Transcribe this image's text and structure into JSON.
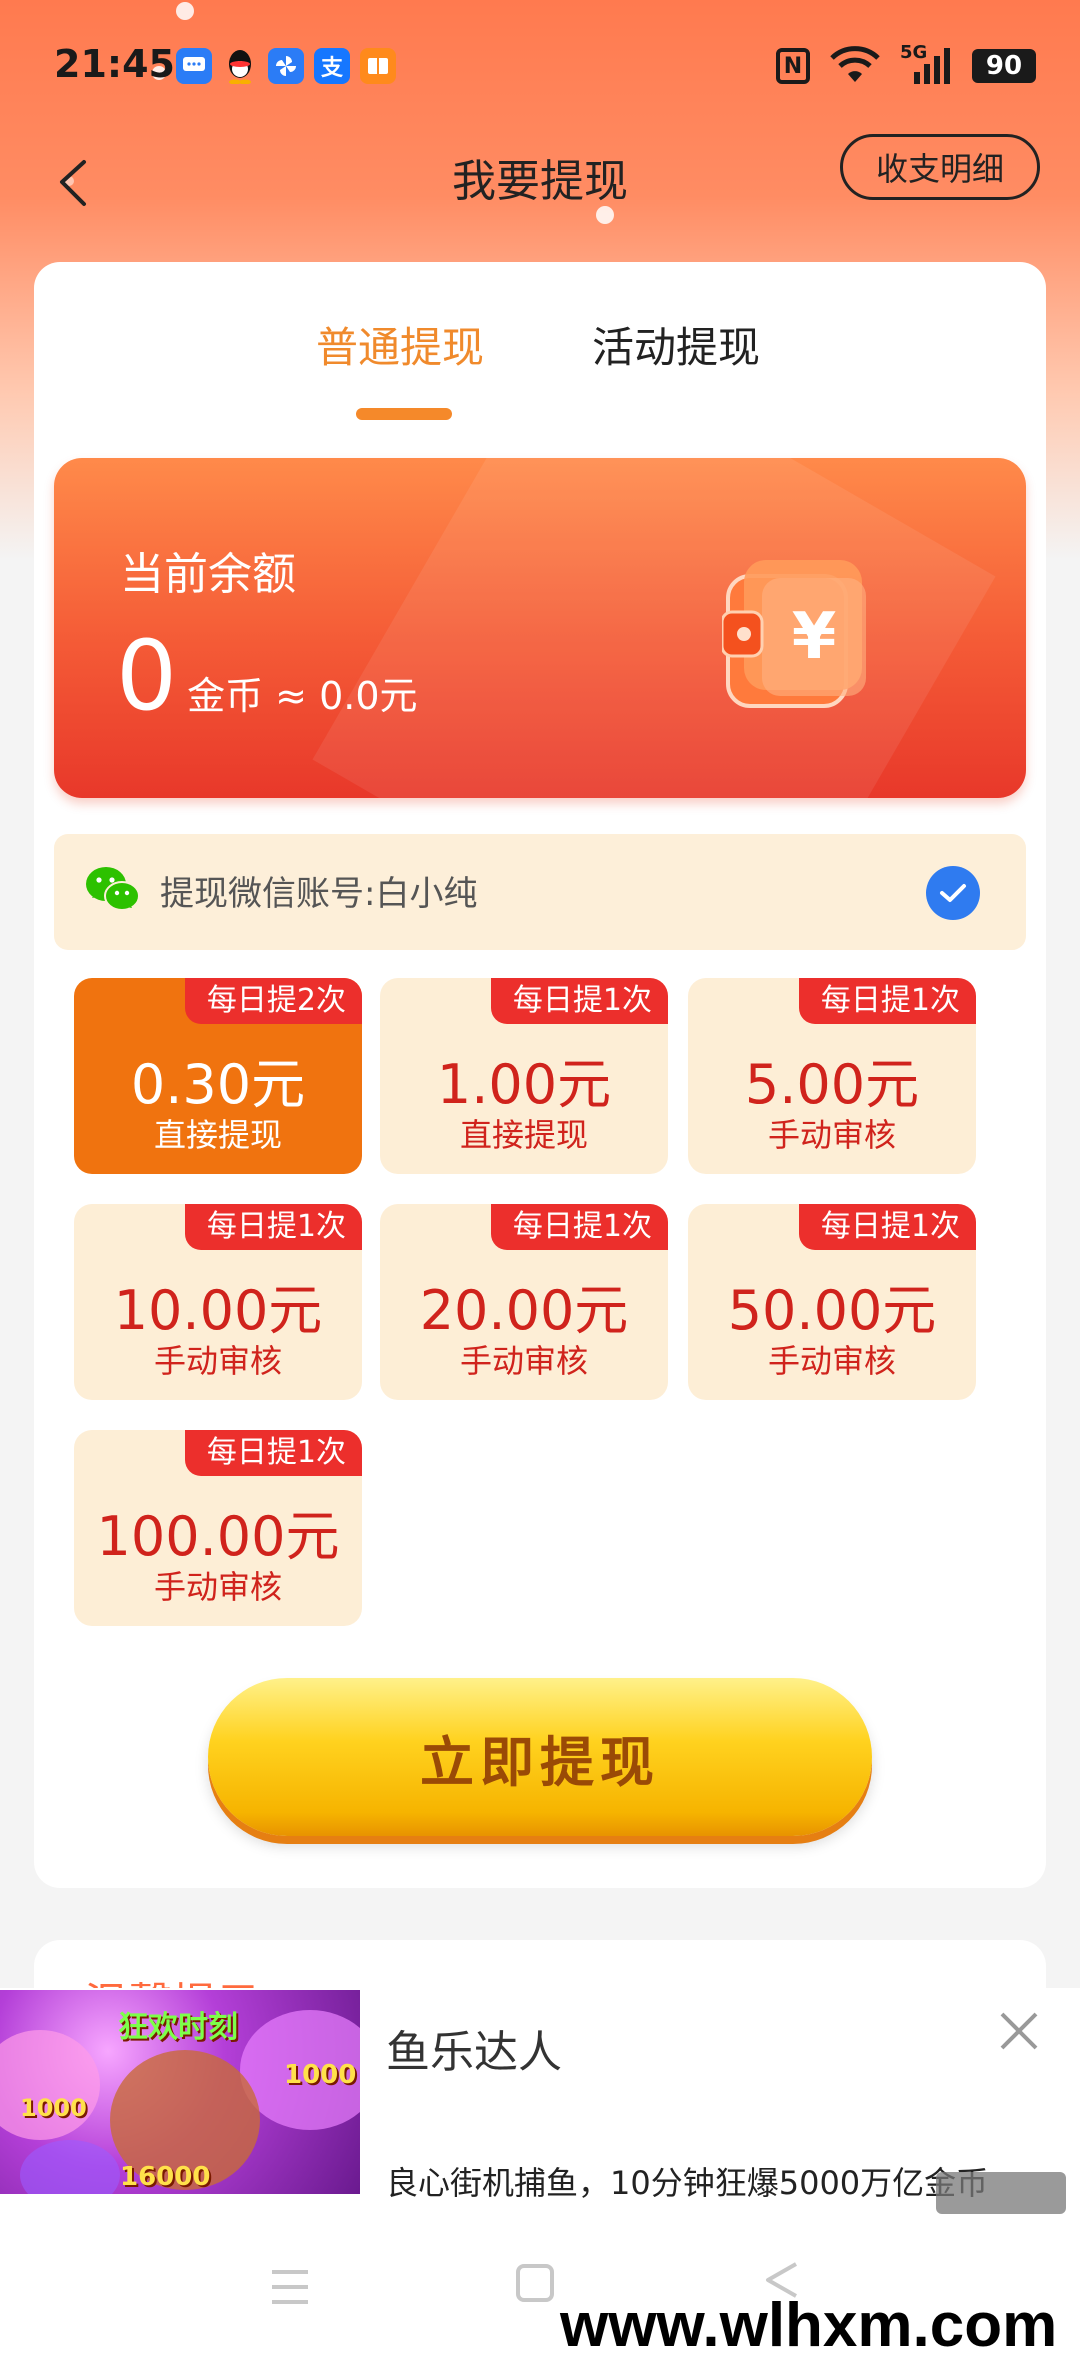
{
  "status_bar": {
    "time": "21:45",
    "notifications": [
      {
        "name": "message-icon",
        "glyph": "▪",
        "color": "#2b7cf6"
      },
      {
        "name": "qq-icon",
        "glyph": "◉",
        "color": "#1a1a1a"
      },
      {
        "name": "pinwheel-app-icon",
        "glyph": "✻",
        "color": "#2b7cf6"
      },
      {
        "name": "alipay-icon",
        "glyph": "支",
        "color": "#1677ff"
      },
      {
        "name": "book-app-icon",
        "glyph": "▤",
        "color": "#ff8a1c"
      }
    ],
    "nfc": "N",
    "network": "5G",
    "battery": "90"
  },
  "nav": {
    "title": "我要提现",
    "records_button": "收支明细"
  },
  "tabs": {
    "normal": "普通提现",
    "activity": "活动提现"
  },
  "balance": {
    "label": "当前余额",
    "value": "0",
    "unit": "金币 ≈ 0.0元"
  },
  "wechat": {
    "account_text": "提现微信账号:白小纯"
  },
  "amounts": [
    {
      "badge": "每日提2次",
      "value": "0.30元",
      "sub": "直接提现",
      "selected": true
    },
    {
      "badge": "每日提1次",
      "value": "1.00元",
      "sub": "直接提现",
      "selected": false
    },
    {
      "badge": "每日提1次",
      "value": "5.00元",
      "sub": "手动审核",
      "selected": false
    },
    {
      "badge": "每日提1次",
      "value": "10.00元",
      "sub": "手动审核",
      "selected": false
    },
    {
      "badge": "每日提1次",
      "value": "20.00元",
      "sub": "手动审核",
      "selected": false
    },
    {
      "badge": "每日提1次",
      "value": "50.00元",
      "sub": "手动审核",
      "selected": false
    },
    {
      "badge": "每日提1次",
      "value": "100.00元",
      "sub": "手动审核",
      "selected": false
    }
  ],
  "withdraw_button": "立即提现",
  "tips": {
    "title": "温馨提示"
  },
  "ad": {
    "title": "鱼乐达人",
    "description": "良心街机捕鱼，10分钟狂爆5000万亿金币",
    "image_banner": "狂欢时刻",
    "image_numbers": [
      "1000",
      "16000",
      "1000"
    ]
  },
  "watermark": "www.wlhxm.com",
  "colors": {
    "accent_orange": "#f5892a",
    "selected_card": "#f0730f",
    "badge_red": "#ec2f2c",
    "amount_text": "#d0231c",
    "button_yellow": "#ffd21f",
    "check_blue": "#2f7bf0"
  }
}
